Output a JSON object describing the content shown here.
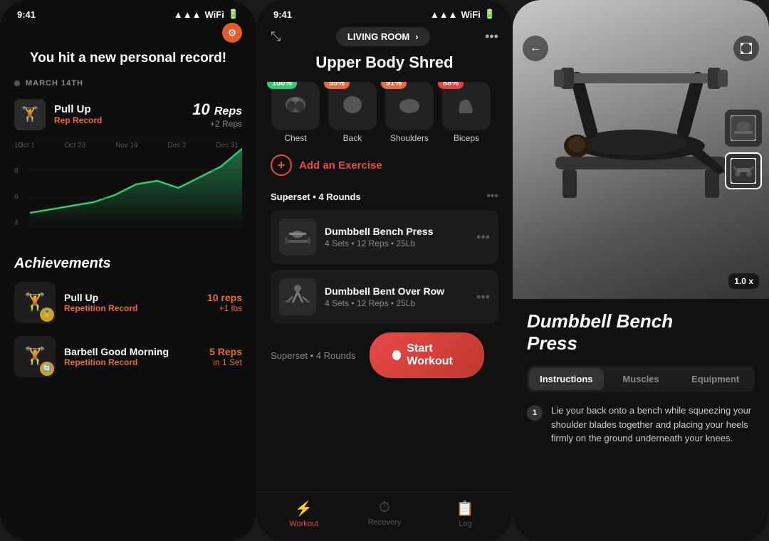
{
  "screen1": {
    "status_time": "9:41",
    "header_gear": "⚙",
    "title": "You hit a new personal record!",
    "date": "MARCH 14TH",
    "record": {
      "exercise": "Pull Up",
      "tag": "Rep Record",
      "value": "10",
      "unit": "Reps",
      "change": "+2 Reps",
      "thumb": "🏋"
    },
    "chart_x_labels": [
      "Oct 1",
      "Oct 23",
      "Nov 19",
      "Dec 2",
      "Dec 31"
    ],
    "chart_y_labels": [
      "10",
      "8",
      "6",
      "4"
    ],
    "achievements_title": "Achievements",
    "achievements": [
      {
        "name": "Pull Up",
        "sub": "Repetition Record",
        "value": "10 reps",
        "change": "+1 lbs",
        "emoji": "🏋",
        "badge": "🏅"
      },
      {
        "name": "Barbell Good Morning",
        "sub": "Repetition Record",
        "value": "5 Reps",
        "change": "in 1 Set",
        "emoji": "🏋",
        "badge": "🔄"
      }
    ]
  },
  "screen2": {
    "status_time": "9:41",
    "location": "LIVING ROOM",
    "title": "Upper Body Shred",
    "muscles": [
      {
        "label": "Chest",
        "badge": "100%",
        "badge_class": "badge-green",
        "emoji": "🫀"
      },
      {
        "label": "Back",
        "badge": "95%",
        "badge_class": "badge-orange",
        "emoji": "🔙"
      },
      {
        "label": "Shoulders",
        "badge": "91%",
        "badge_class": "badge-orange",
        "emoji": "💪"
      },
      {
        "label": "Biceps",
        "badge": "88%",
        "badge_class": "badge-red",
        "emoji": "💪"
      }
    ],
    "add_exercise": "Add an Exercise",
    "superset1": {
      "label": "Superset",
      "rounds": "4 Rounds",
      "exercises": [
        {
          "name": "Dumbbell Bench Press",
          "detail": "4 Sets • 12 Reps • 25Lb",
          "emoji": "🏋️"
        },
        {
          "name": "Dumbbell Bent Over Row",
          "detail": "4 Sets • 12 Reps • 25Lb",
          "emoji": "🤸"
        }
      ]
    },
    "superset2": {
      "label": "Superset",
      "rounds": "4 Rounds"
    },
    "start_workout": "Start Workout",
    "nav": [
      {
        "label": "Workout",
        "icon": "⚡",
        "active": true
      },
      {
        "label": "Recovery",
        "icon": "⏱",
        "active": false
      },
      {
        "label": "Log",
        "icon": "📋",
        "active": false
      }
    ]
  },
  "screen3": {
    "status_time": "9:41",
    "exercise_title": "Dumbbell Bench\nPress",
    "tabs": [
      "Instructions",
      "Muscles",
      "Equipment"
    ],
    "active_tab": "Instructions",
    "speed": "1.0 x",
    "instruction": "Lie your back onto a bench while squeezing your shoulder blades together and placing your heels firmly on the ground underneath your knees.",
    "instruction_num": "1"
  }
}
